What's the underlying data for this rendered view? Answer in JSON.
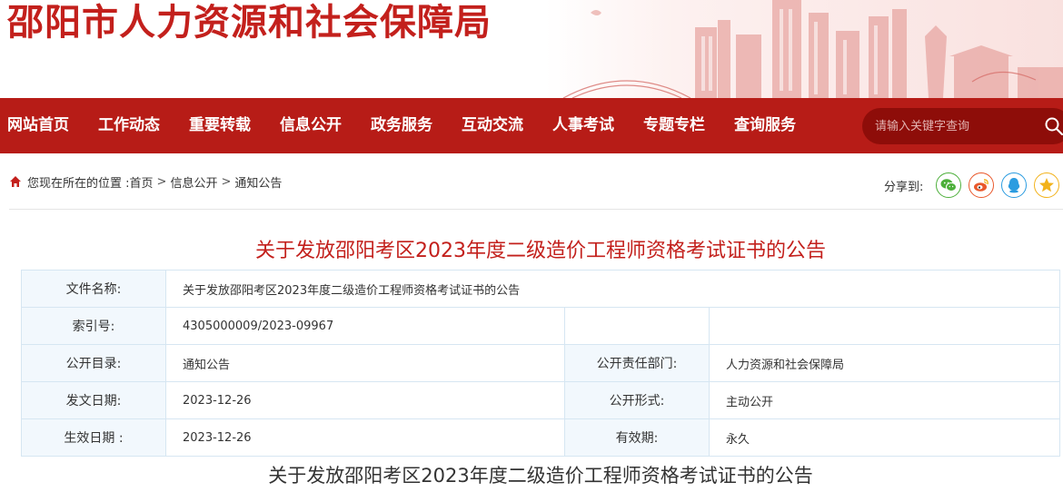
{
  "header": {
    "site_title": "邵阳市人力资源和社会保障局"
  },
  "nav": {
    "items": [
      {
        "label": "网站首页"
      },
      {
        "label": "工作动态"
      },
      {
        "label": "重要转载"
      },
      {
        "label": "信息公开"
      },
      {
        "label": "政务服务"
      },
      {
        "label": "互动交流"
      },
      {
        "label": "人事考试"
      },
      {
        "label": "专题专栏"
      },
      {
        "label": "查询服务"
      }
    ],
    "search": {
      "placeholder": "请输入关键字查询",
      "icon": "search-icon"
    }
  },
  "breadcrumb": {
    "prefix": "您现在所在的位置 : ",
    "items": [
      "首页",
      "信息公开",
      "通知公告"
    ],
    "separator": ">"
  },
  "share": {
    "label": "分享到:",
    "buttons": [
      {
        "icon": "wechat-icon",
        "color": "#4caf3a"
      },
      {
        "icon": "weibo-icon",
        "color": "#e9582b"
      },
      {
        "icon": "qq-icon",
        "color": "#2b9ce0"
      },
      {
        "icon": "qzone-icon",
        "color": "#f2b21b"
      }
    ]
  },
  "article": {
    "title": "关于发放邵阳考区2023年度二级造价工程师资格考试证书的公告",
    "body_title": "关于发放邵阳考区2023年度二级造价工程师资格考试证书的公告"
  },
  "info": {
    "doc_name_label": "文件名称:",
    "doc_name": "关于发放邵阳考区2023年度二级造价工程师资格考试证书的公告",
    "index_label": "索引号:",
    "index": "4305000009/2023-09967",
    "catalog_label": "公开目录:",
    "catalog": "通知公告",
    "dept_label": "公开责任部门:",
    "dept": "人力资源和社会保障局",
    "issue_date_label": "发文日期:",
    "issue_date": "2023-12-26",
    "form_label": "公开形式:",
    "form": "主动公开",
    "effective_date_label": "生效日期 :",
    "effective_date": "2023-12-26",
    "validity_label": "有效期:",
    "validity": "永久"
  },
  "colors": {
    "brand_red": "#c3201c",
    "nav_red": "#b71c17",
    "search_dark": "#8e0d09"
  }
}
